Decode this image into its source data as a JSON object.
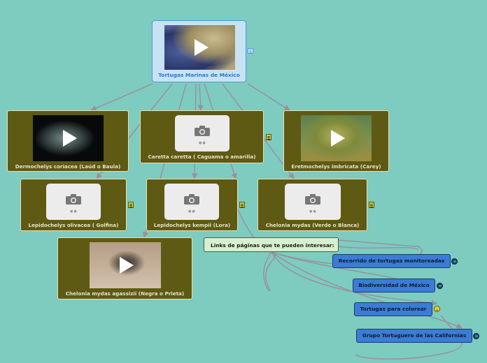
{
  "root": {
    "label": "Tortugas Marinas de México",
    "media": "video",
    "icon": "note-icon"
  },
  "species": [
    {
      "id": "dermochelys",
      "label": "Dermochelys coriacea (Laúd o Baula)",
      "media": "video"
    },
    {
      "id": "caretta",
      "label": "Caretta caretta ( Caguama o amarilla)",
      "media": "photo-placeholder",
      "icon": "note-icon"
    },
    {
      "id": "eretmochelys",
      "label": "Eretmochelys imbricata (Carey)",
      "media": "video"
    },
    {
      "id": "olivacea",
      "label": "Lepidochelys olivacea ( Golfina)",
      "media": "photo-placeholder",
      "icon": "note-icon"
    },
    {
      "id": "kempii",
      "label": "Lepidochelys kempii (Lora)",
      "media": "photo-placeholder",
      "icon": "note-icon"
    },
    {
      "id": "mydas",
      "label": "Chelonia mydas (Verde o Blanca)",
      "media": "photo-placeholder",
      "icon": "note-icon"
    },
    {
      "id": "agassizii",
      "label": "Chelonia mydas agassizii (Negra o Prieta)",
      "media": "video"
    }
  ],
  "links_header": "Links de páginas que te pueden interesar:",
  "links": [
    {
      "label": "Recorrido de tortugas monitoreadas",
      "icon": "globe-icon"
    },
    {
      "label": "Biodiversidad de México",
      "icon": "globe-icon"
    },
    {
      "label": "Tortugas para colorear",
      "icon": "smiley-icon"
    },
    {
      "label": "Grupo Tortuguero de las Californias",
      "icon": "globe-icon"
    }
  ],
  "colors": {
    "background": "#7ecbc0",
    "species_node": "#5e5a14",
    "root_node": "#c7e3f3",
    "root_text": "#2a79c9",
    "link_node": "#3a7cd6",
    "links_header": "#d7f0cf",
    "connector": "#9a8f98"
  }
}
